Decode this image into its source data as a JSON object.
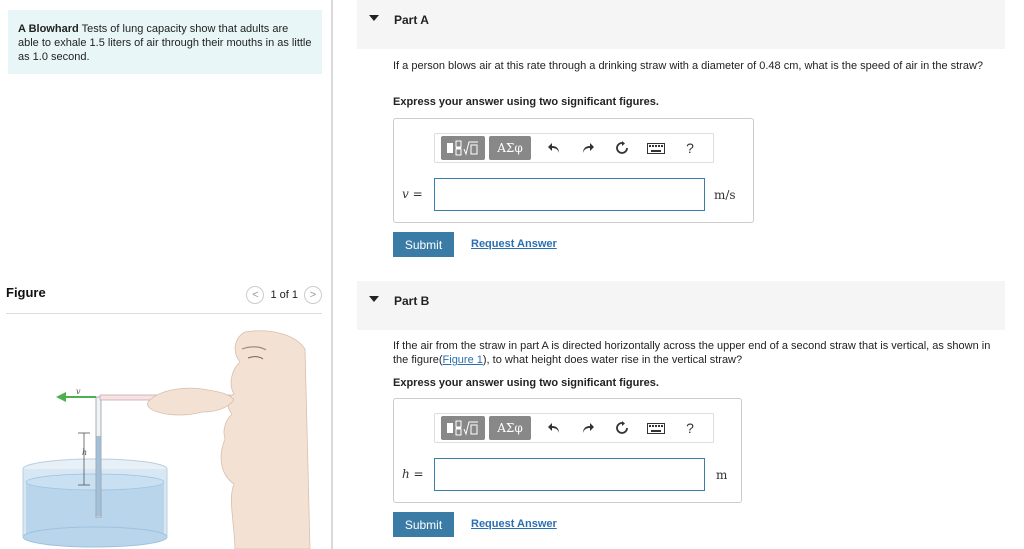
{
  "problem": {
    "title": "A Blowhard",
    "text": " Tests of lung capacity show that adults are able to exhale 1.5 liters of air through their mouths in as little as 1.0 second."
  },
  "figure_panel": {
    "title": "Figure",
    "pager_text": "1 of 1",
    "prev_icon": "<",
    "next_icon": ">",
    "label_v": "v",
    "label_h": "h"
  },
  "part_a": {
    "title": "Part A",
    "question": "If a person blows air at this rate through a drinking straw with a diameter of 0.48 cm, what is the speed of air in the straw?",
    "instruction": "Express your answer using two significant figures.",
    "variable": "v =",
    "unit": "m/s",
    "input_value": "",
    "submit_label": "Submit",
    "request_label": "Request Answer"
  },
  "part_b": {
    "title": "Part B",
    "question_before": "If the air from the straw in part A is directed horizontally across the upper end of a second straw that is vertical, as shown in the figure(",
    "figure_link": "Figure 1",
    "question_after": "), to what height does water rise in the vertical straw?",
    "instruction": "Express your answer using two significant figures.",
    "variable": "h =",
    "unit": "m",
    "input_value": "",
    "submit_label": "Submit",
    "request_label": "Request Answer"
  },
  "toolbar": {
    "greek_label": "ΑΣφ",
    "help_label": "?"
  },
  "colors": {
    "problem_bg": "#e9f6f7",
    "submit_bg": "#3b7ca6",
    "link": "#2a6fb0",
    "input_border": "#3a7fa8",
    "arrow_green": "#4caf50"
  }
}
